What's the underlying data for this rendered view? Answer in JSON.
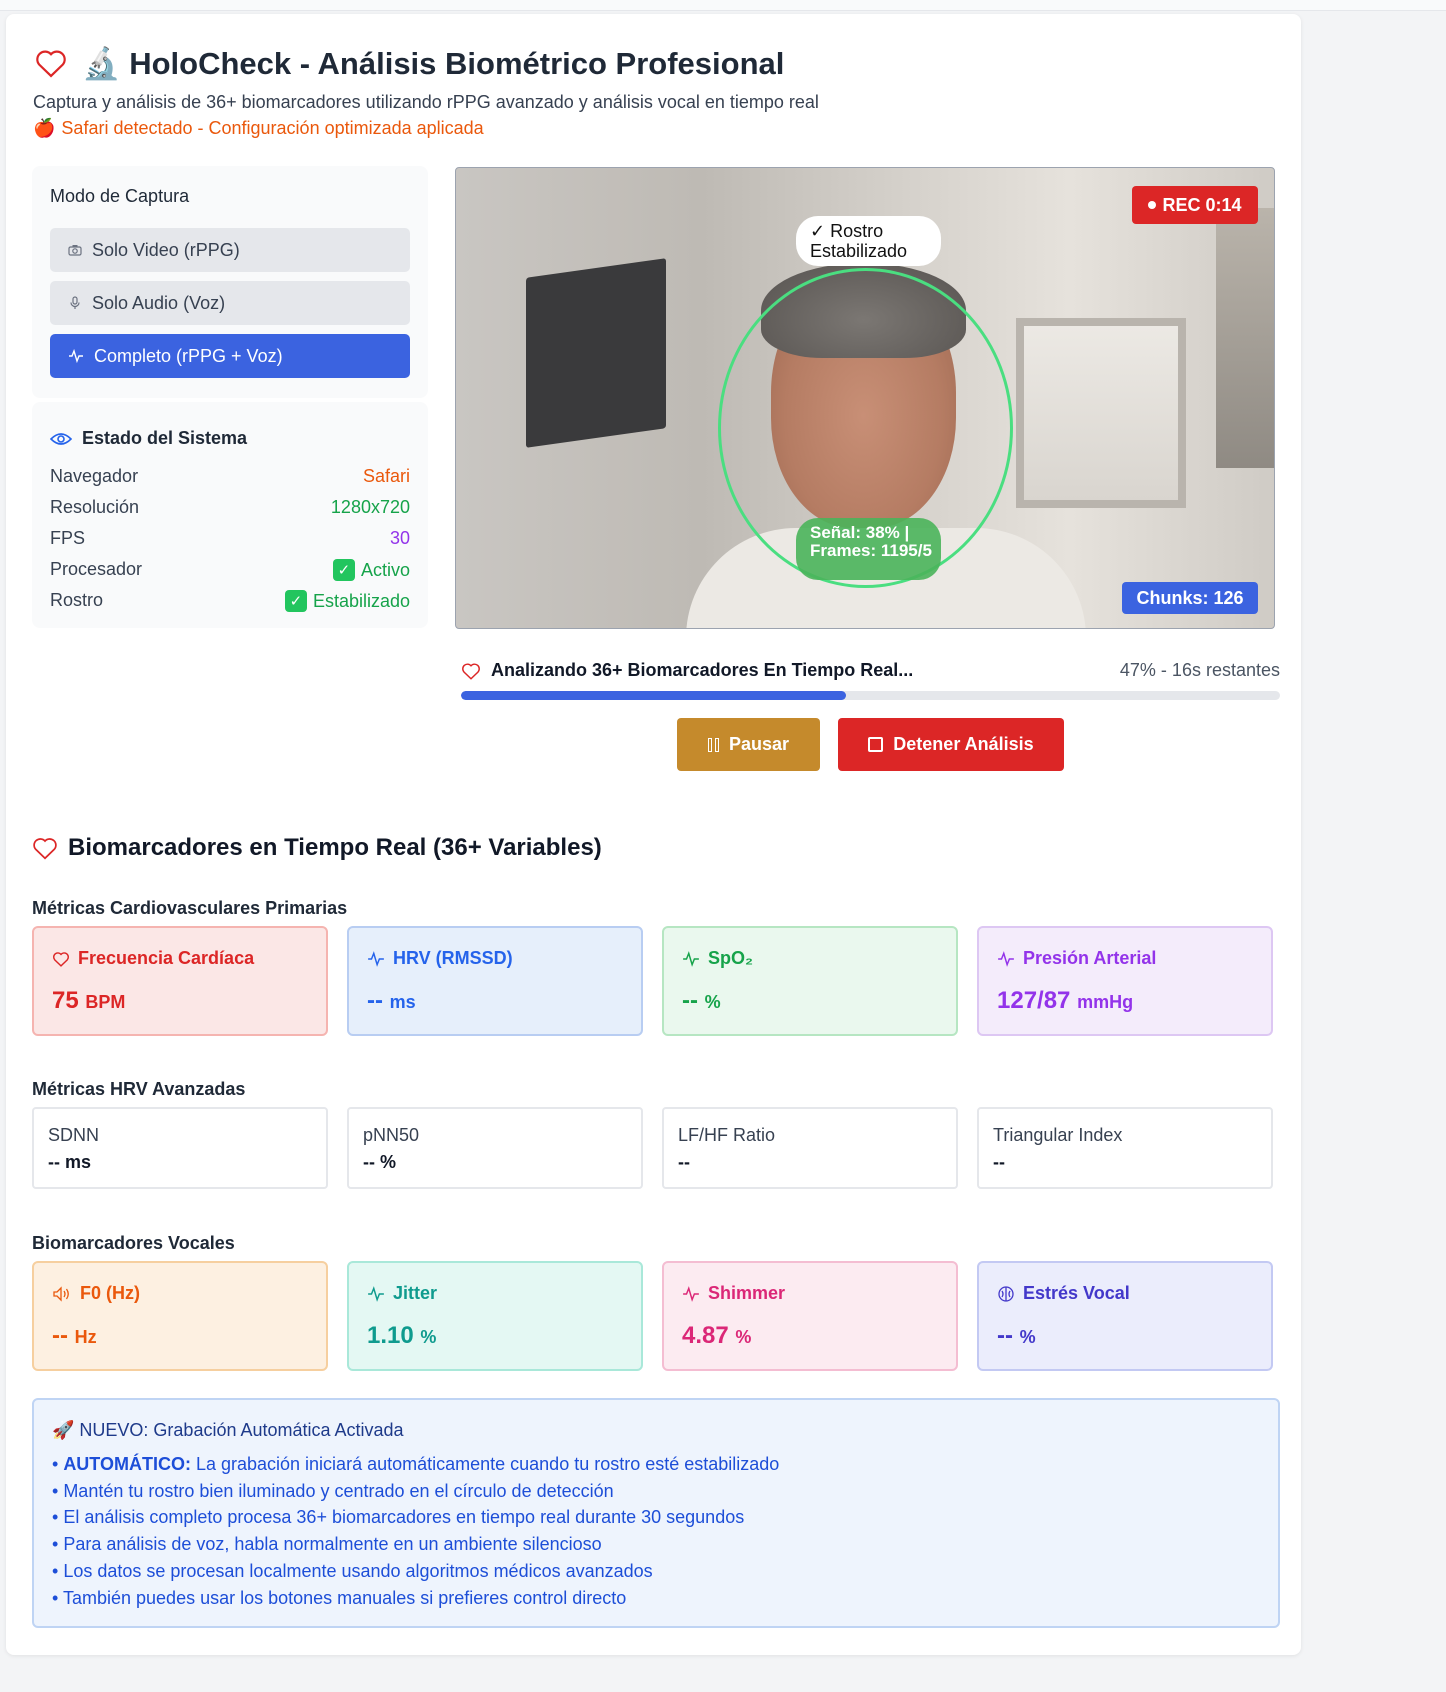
{
  "header": {
    "title": "🔬 HoloCheck - Análisis Biométrico Profesional",
    "subtitle": "Captura y análisis de 36+ biomarcadores utilizando rPPG avanzado y análisis vocal en tiempo real",
    "browser_note": "Safari detectado - Configuración optimizada aplicada"
  },
  "capture_mode": {
    "title": "Modo de Captura",
    "options": [
      {
        "label": "Solo Video (rPPG)",
        "icon": "camera-icon",
        "active": false
      },
      {
        "label": "Solo Audio (Voz)",
        "icon": "microphone-icon",
        "active": false
      },
      {
        "label": "Completo (rPPG + Voz)",
        "icon": "activity-icon",
        "active": true
      }
    ]
  },
  "system_status": {
    "title": "Estado del Sistema",
    "rows": [
      {
        "label": "Navegador",
        "value": "Safari",
        "color": "#ea580c"
      },
      {
        "label": "Resolución",
        "value": "1280x720",
        "color": "#16a34a"
      },
      {
        "label": "FPS",
        "value": "30",
        "color": "#9333ea"
      },
      {
        "label": "Procesador",
        "value": "Activo",
        "color": "#16a34a"
      },
      {
        "label": "Rostro",
        "value": "Estabilizado",
        "color": "#16a34a"
      }
    ]
  },
  "video": {
    "face_status": "✓ Rostro Estabilizado",
    "signal_info": "Señal: 38% | Frames: 1195/5",
    "rec_label": "REC 0:14",
    "chunks_label": "Chunks: 126"
  },
  "progress": {
    "label": "Analizando 36+ Biomarcadores En Tiempo Real...",
    "status": "47% - 16s restantes",
    "percent": 47
  },
  "controls": {
    "pause_label": "Pausar",
    "stop_label": "Detener Análisis"
  },
  "biomarkers": {
    "title": "Biomarcadores en Tiempo Real (36+ Variables)",
    "cardio_title": "Métricas Cardiovasculares Primarias",
    "cardio": [
      {
        "label": "Frecuencia Cardíaca",
        "value": "75",
        "unit": "BPM",
        "icon": "heart-icon",
        "color": "#dc2626",
        "bg": "#fbe7e6",
        "border": "#f5b4b0"
      },
      {
        "label": "HRV (RMSSD)",
        "value": "--",
        "unit": "ms",
        "icon": "activity-icon",
        "color": "#2563eb",
        "bg": "#e6effb",
        "border": "#b8cdf2"
      },
      {
        "label": "SpO₂",
        "value": "--",
        "unit": "%",
        "icon": "activity-icon",
        "color": "#16a34a",
        "bg": "#eaf8ee",
        "border": "#b6e6c2"
      },
      {
        "label": "Presión Arterial",
        "value": "127/87",
        "unit": "mmHg",
        "icon": "activity-icon",
        "color": "#9333ea",
        "bg": "#f4ecfb",
        "border": "#ddc7f3"
      }
    ],
    "hrv_title": "Métricas HRV Avanzadas",
    "hrv": [
      {
        "label": "SDNN",
        "value": "-- ms"
      },
      {
        "label": "pNN50",
        "value": "-- %"
      },
      {
        "label": "LF/HF Ratio",
        "value": "--"
      },
      {
        "label": "Triangular Index",
        "value": "--"
      }
    ],
    "vocal_title": "Biomarcadores Vocales",
    "vocal": [
      {
        "label": "F0 (Hz)",
        "value": "--",
        "unit": "Hz",
        "icon": "speaker-icon",
        "color": "#ea580c",
        "bg": "#fdf0e1",
        "border": "#f6cf9f"
      },
      {
        "label": "Jitter",
        "value": "1.10",
        "unit": "%",
        "icon": "activity-icon",
        "color": "#0f9b8e",
        "bg": "#e4f8f3",
        "border": "#a9e8d9"
      },
      {
        "label": "Shimmer",
        "value": "4.87",
        "unit": "%",
        "icon": "activity-icon",
        "color": "#db2777",
        "bg": "#fcebf1",
        "border": "#f4bdd2"
      },
      {
        "label": "Estrés Vocal",
        "value": "--",
        "unit": "%",
        "icon": "brain-icon",
        "color": "#4338ca",
        "bg": "#ebedfc",
        "border": "#c3c9f3"
      }
    ]
  },
  "info": {
    "title": "🚀 NUEVO: Grabación Automática Activada",
    "auto_label": "AUTOMÁTICO:",
    "auto_text": " La grabación iniciará automáticamente cuando tu rostro esté estabilizado",
    "items": [
      "Mantén tu rostro bien iluminado y centrado en el círculo de detección",
      "El análisis completo procesa 36+ biomarcadores en tiempo real durante 30 segundos",
      "Para análisis de voz, habla normalmente en un ambiente silencioso",
      "Los datos se procesan localmente usando algoritmos médicos avanzados",
      "También puedes usar los botones manuales si prefieres control directo"
    ]
  }
}
